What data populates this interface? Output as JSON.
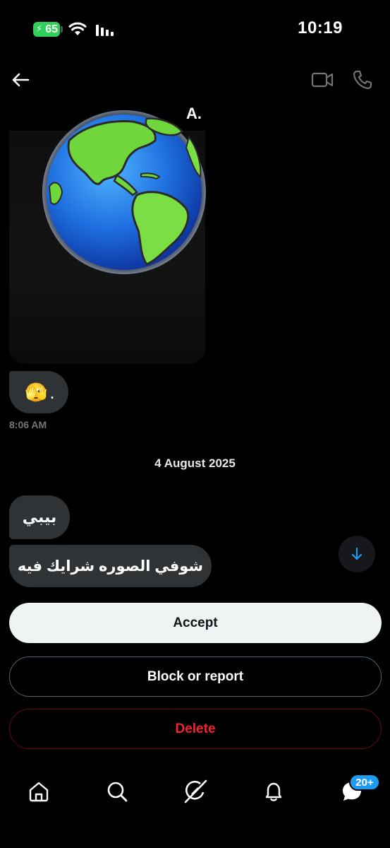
{
  "status_bar": {
    "battery_level": "65",
    "time": "10:19"
  },
  "header": {
    "contact_name": "A."
  },
  "conversation": {
    "emoji_message": "🫣",
    "emoji_suffix": ".",
    "timestamp": "8:06 AM",
    "date_separator": "4 August 2025",
    "messages": [
      {
        "text": "بيبي"
      },
      {
        "text": "شوفي الصوره شرايك فيه"
      }
    ]
  },
  "actions": {
    "accept_label": "Accept",
    "block_label": "Block or report",
    "delete_label": "Delete"
  },
  "nav": {
    "items": [
      "home-icon",
      "search-icon",
      "grok-icon",
      "notifications-icon",
      "messages-icon"
    ],
    "messages_badge": "20+"
  },
  "colors": {
    "accent": "#1d9bf0",
    "danger": "#f4212e",
    "bubble": "#2f3336"
  }
}
